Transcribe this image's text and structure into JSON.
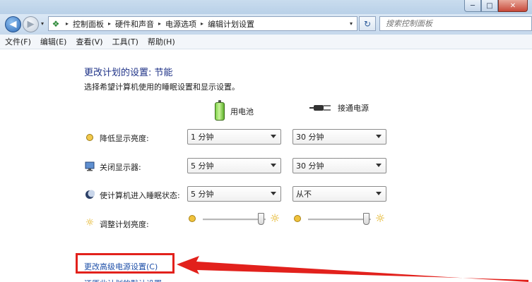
{
  "window": {
    "minimize_glyph": "─",
    "maximize_glyph": "□",
    "close_glyph": "✕"
  },
  "nav": {
    "back_glyph": "◀",
    "forward_glyph": "▶",
    "dropdown_glyph": "▾"
  },
  "address": {
    "icon": "control-panel-icon",
    "breadcrumbs": [
      "控制面板",
      "硬件和声音",
      "电源选项",
      "编辑计划设置"
    ],
    "separator": "▸",
    "dropdown_glyph": "▾"
  },
  "refresh_glyph": "↻",
  "search": {
    "placeholder": "搜索控制面板",
    "value": ""
  },
  "menu": {
    "items": [
      "文件(F)",
      "编辑(E)",
      "查看(V)",
      "工具(T)",
      "帮助(H)"
    ]
  },
  "page": {
    "title": "更改计划的设置: 节能",
    "subtitle": "选择希望计算机使用的睡眠设置和显示设置。"
  },
  "columns": {
    "battery": {
      "label": "用电池",
      "icon": "battery-icon"
    },
    "plugged": {
      "label": "接通电源",
      "icon": "power-plug-icon"
    }
  },
  "settings": [
    {
      "label": "降低显示亮度:",
      "icon": "dim-display-icon",
      "battery": "1 分钟",
      "plugged": "30 分钟"
    },
    {
      "label": "关闭显示器:",
      "icon": "monitor-icon",
      "battery": "5 分钟",
      "plugged": "30 分钟"
    },
    {
      "label": "使计算机进入睡眠状态:",
      "icon": "sleep-moon-icon",
      "battery": "5 分钟",
      "plugged": "从不"
    }
  ],
  "brightness": {
    "label": "调整计划亮度:",
    "icon": "brightness-sun-icon",
    "battery_level": 0.92,
    "plugged_level": 0.92
  },
  "links": {
    "advanced": "更改高级电源设置(C)",
    "partial_next": "还原此计划的默认设置"
  },
  "colors": {
    "title_blue": "#1e3287",
    "link_blue": "#1e4fa8",
    "highlight_red": "#e2211c"
  }
}
